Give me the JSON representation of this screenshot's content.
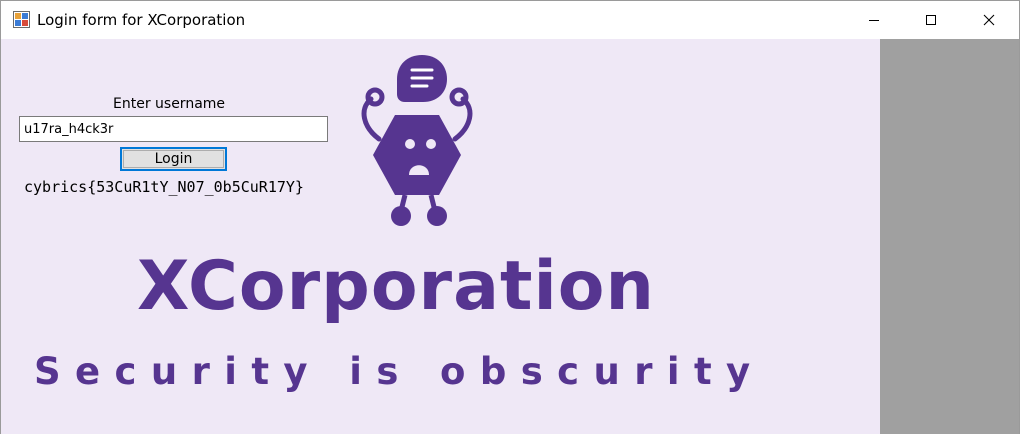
{
  "window": {
    "title": "Login form for XCorporation",
    "app_icon": "windows-forms-app-icon",
    "controls": [
      "minimize-icon",
      "maximize-icon",
      "close-icon"
    ]
  },
  "form": {
    "username_label": "Enter username",
    "username_value": "u17ra_h4ck3r",
    "login_label": "Login",
    "flag_text": "cybrics{53CuR1tY_N07_0b5CuR17Y}"
  },
  "branding": {
    "logo_icon": "robot-icon",
    "company_name": "XCorporation",
    "tagline": "Security is obscurity"
  },
  "colors": {
    "brand_purple": "#563590",
    "panel_background": "#efe8f6",
    "focus_blue": "#0078d7",
    "client_gray": "#a0a0a0"
  }
}
